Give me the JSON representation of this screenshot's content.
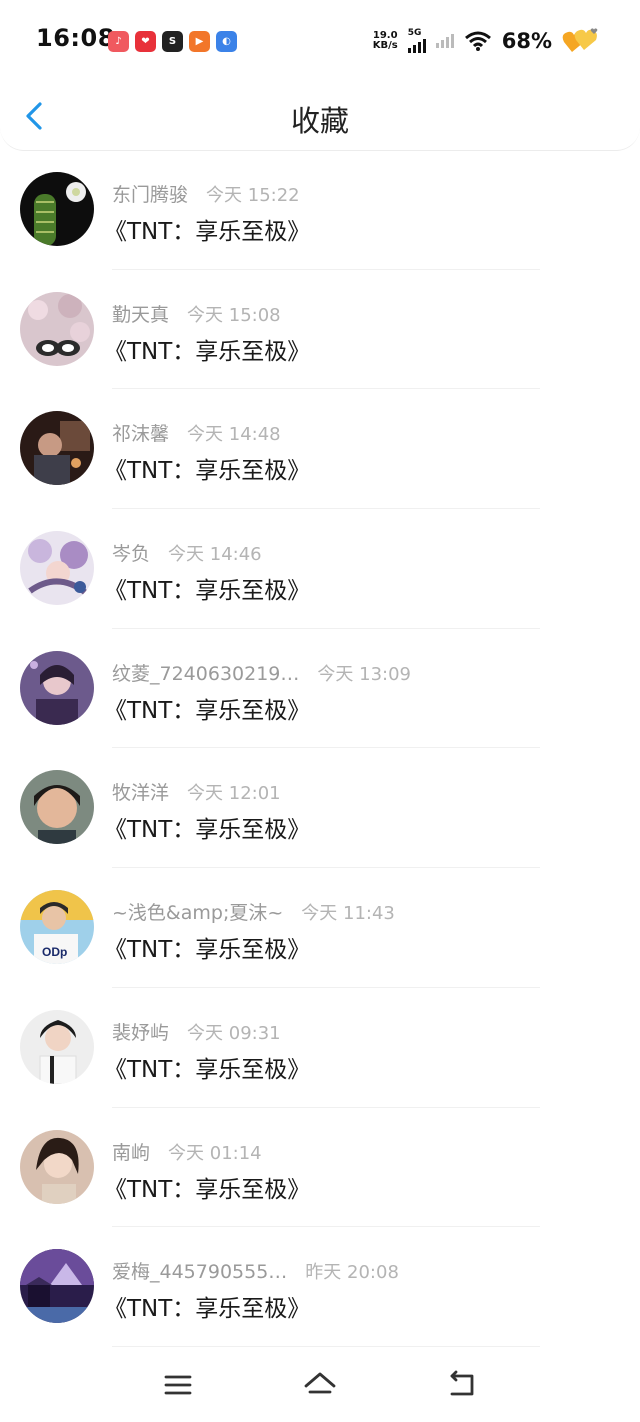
{
  "status_bar": {
    "time": "16:08",
    "net_speed_value": "19.0",
    "net_speed_unit": "KB/s",
    "signal_label": "5G",
    "battery": "68%"
  },
  "header": {
    "title": "收藏"
  },
  "items": [
    {
      "name": "东门腾骏",
      "time": "今天 15:22",
      "content": "《TNT：享乐至极》"
    },
    {
      "name": "勤天真",
      "time": "今天 15:08",
      "content": "《TNT：享乐至极》"
    },
    {
      "name": "祁沫馨",
      "time": "今天 14:48",
      "content": "《TNT：享乐至极》"
    },
    {
      "name": "岑负",
      "time": "今天 14:46",
      "content": "《TNT：享乐至极》"
    },
    {
      "name": "纹菱_7240630219…",
      "time": "今天 13:09",
      "content": "《TNT：享乐至极》"
    },
    {
      "name": "牧洋洋",
      "time": "今天 12:01",
      "content": "《TNT：享乐至极》"
    },
    {
      "name": "~浅色&amp;夏沫~",
      "time": "今天 11:43",
      "content": "《TNT：享乐至极》"
    },
    {
      "name": "裴妤屿",
      "time": "今天 09:31",
      "content": "《TNT：享乐至极》"
    },
    {
      "name": "南岣",
      "time": "今天 01:14",
      "content": "《TNT：享乐至极》"
    },
    {
      "name": "爱梅_445790555…",
      "time": "昨天 20:08",
      "content": "《TNT：享乐至极》"
    }
  ],
  "colors": {
    "accent": "#2196e8",
    "timestamp": "#b4b4b4",
    "name": "#9a9a9a"
  },
  "nav_icons": [
    "menu-icon",
    "home-icon",
    "back-icon"
  ]
}
